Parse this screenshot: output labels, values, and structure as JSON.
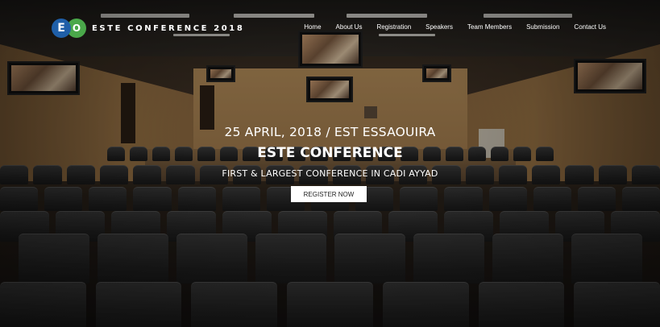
{
  "brand": {
    "logo_letters": [
      "E",
      "O"
    ],
    "name": "ESTE CONFERENCE 2018",
    "colors": {
      "logo_blue": "#1f5fa8",
      "logo_green": "#4aa84a"
    }
  },
  "nav": {
    "items": [
      {
        "label": "Home"
      },
      {
        "label": "About Us"
      },
      {
        "label": "Registration"
      },
      {
        "label": "Speakers"
      },
      {
        "label": "Team Members"
      },
      {
        "label": "Submission"
      },
      {
        "label": "Contact Us"
      }
    ]
  },
  "hero": {
    "date_location": "25 APRIL, 2018 / EST ESSAOUIRA",
    "title": "ESTE CONFERENCE",
    "subtitle": "FIRST & LARGEST CONFERENCE IN CADI AYYAD",
    "cta_label": "REGISTER NOW",
    "background_image": "auditorium-with-seats-and-screens"
  }
}
